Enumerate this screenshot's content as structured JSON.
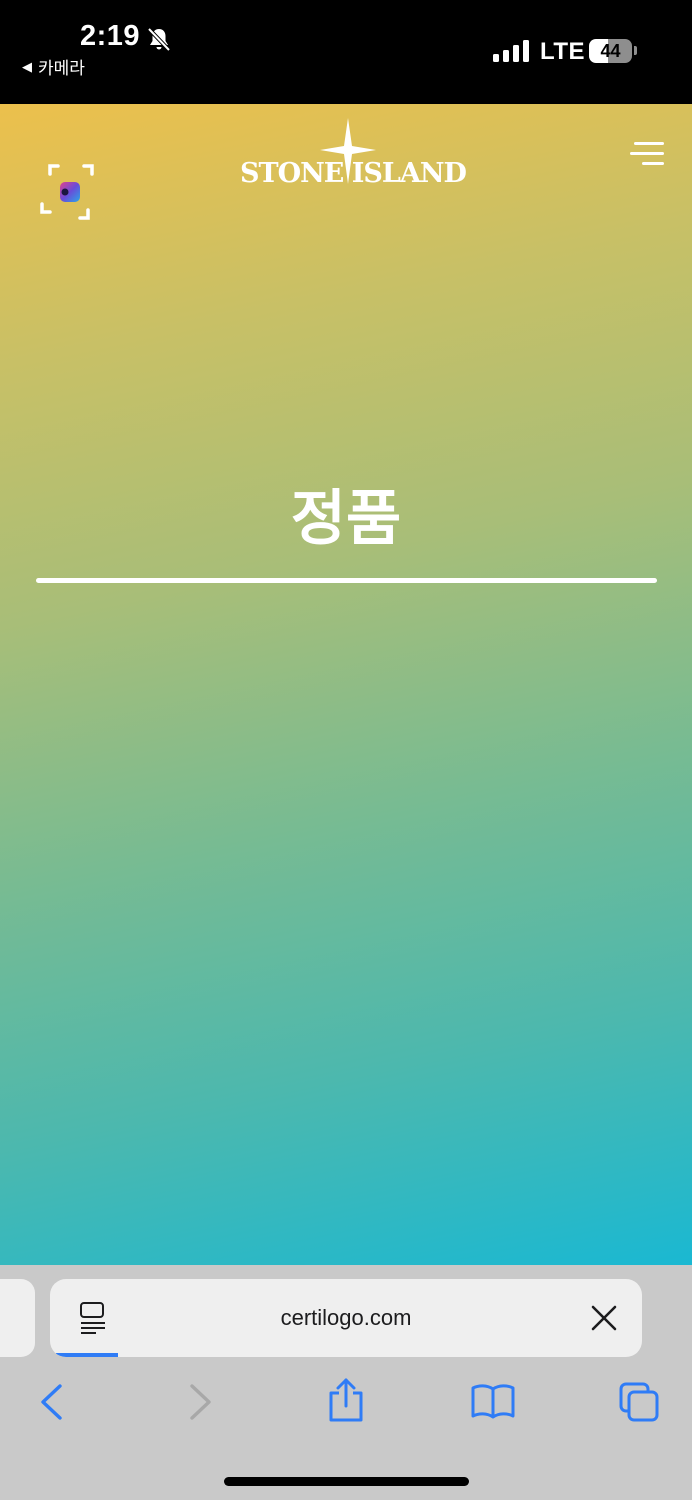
{
  "status_bar": {
    "time": "2:19",
    "back_app_label": "카메라",
    "network": "LTE",
    "battery_level": "44"
  },
  "page": {
    "brand": "STONE ISLAND",
    "heading": "정품"
  },
  "browser": {
    "url": "certilogo.com",
    "accent_color": "#2f7cf6",
    "icons": {
      "reader": "reader-mode-icon",
      "close": "close-icon",
      "back": "chevron-left-icon",
      "forward": "chevron-right-icon",
      "share": "share-icon",
      "bookmarks": "book-icon",
      "tabs": "tabs-icon"
    }
  }
}
